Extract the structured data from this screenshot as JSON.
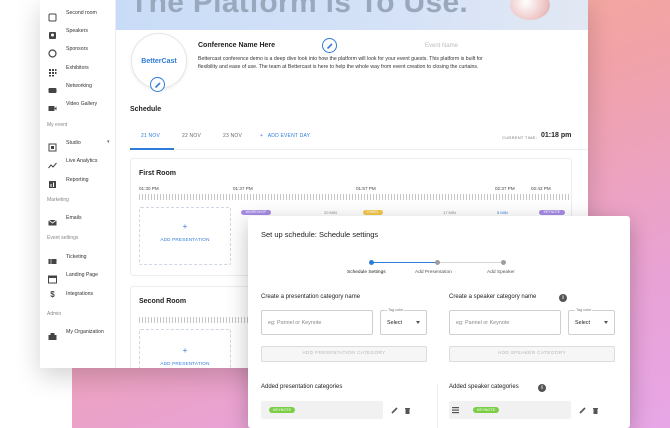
{
  "sidebar": {
    "items": [
      {
        "label": "Second room",
        "icon": "room-icon"
      },
      {
        "label": "Speakers",
        "icon": "person-icon"
      },
      {
        "label": "Sponsors",
        "icon": "badge-icon"
      },
      {
        "label": "Exhibitors",
        "icon": "grid-icon"
      },
      {
        "label": "Networking",
        "icon": "people-icon"
      },
      {
        "label": "Video Gallery",
        "icon": "video-icon"
      }
    ],
    "sections": {
      "my_event": "My event",
      "marketing": "Marketing",
      "event_settings": "Event settings",
      "admin": "Admin"
    },
    "my_event_items": [
      {
        "label": "Studio",
        "icon": "studio-icon"
      },
      {
        "label": "Live Analytics",
        "icon": "chart-icon"
      },
      {
        "label": "Reporting",
        "icon": "report-icon"
      }
    ],
    "marketing_items": [
      {
        "label": "Emails",
        "icon": "mail-icon"
      }
    ],
    "settings_items": [
      {
        "label": "Ticketing",
        "icon": "ticket-icon"
      },
      {
        "label": "Landing Page",
        "icon": "page-icon"
      },
      {
        "label": "Integrations",
        "icon": "dollar-icon"
      }
    ],
    "admin_items": [
      {
        "label": "My Organization",
        "icon": "building-icon"
      }
    ]
  },
  "hero": {
    "title": "The Platform is To Use."
  },
  "event": {
    "logo_text": "BetterCast",
    "name": "Conference Name Here",
    "name_placeholder": "Event Name",
    "description": "Bettercast conference demo is a deep dive look into how the platform will look for your event guests. This platform is built for flexibility and ease of use. The team at Bettercast is here to help the whole way from event creation to closing the curtains."
  },
  "schedule": {
    "title": "Schedule",
    "tabs": [
      "21 NOV",
      "22 NOV",
      "23 NOV"
    ],
    "add_day": "ADD EVENT DAY",
    "current_time_label": "CURRENT TIME:",
    "current_time": "01:18 pm",
    "timeline": [
      "01:30 PM",
      "01:37 PM",
      "01:57 PM",
      "02:37 PM",
      "02:42 PM"
    ],
    "rooms": [
      {
        "title": "First Room",
        "add_label": "ADD PRESENTATION"
      },
      {
        "title": "Second Room",
        "add_label": "ADD PRESENTATION"
      }
    ],
    "chips": [
      "WORKSHOP",
      "PANEL",
      "KEYNOTE"
    ],
    "durations": [
      "20 MIN",
      "17 MIN",
      "5 MIN"
    ]
  },
  "modal": {
    "title": "Set up schedule: Schedule settings",
    "steps": [
      "Schedule Settings",
      "Add Presentation",
      "Add Speaker"
    ],
    "presentation": {
      "title": "Create a presentation category name",
      "placeholder": "eg: Pannel or Keynote",
      "tag_label": "Tag color",
      "tag_value": "Select",
      "button": "ADD PRESENTATION CATEGORY",
      "added_title": "Added presentation categories",
      "added_chip": "KEYNOTE"
    },
    "speaker": {
      "title": "Create a speaker category name",
      "placeholder": "eg: Pannel or Keynote",
      "tag_label": "Tag color",
      "tag_value": "Select",
      "button": "ADD SPEAKER CATEGORY",
      "added_title": "Added speaker categories",
      "added_chip": "KEYNOTE"
    },
    "accent": "#2f7bd8",
    "tag_green": "#7bcf47"
  }
}
